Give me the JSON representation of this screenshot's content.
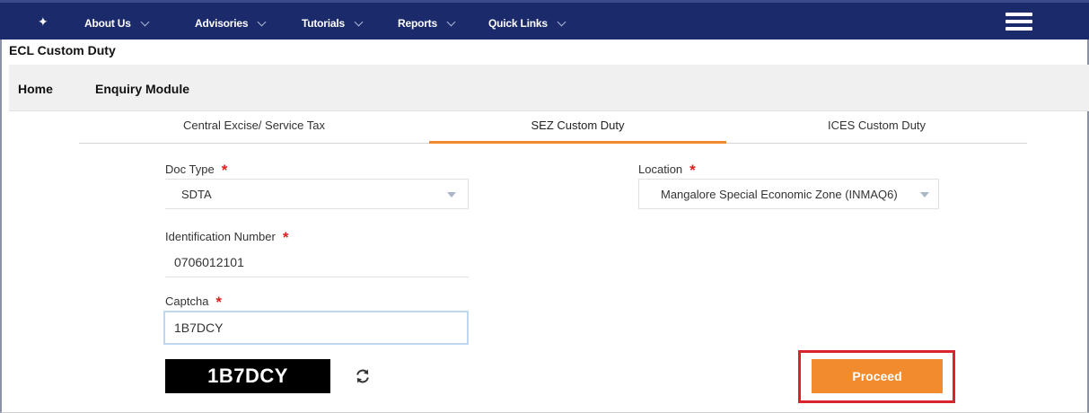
{
  "nav": {
    "home_icon": "home-icon",
    "items": [
      "About Us",
      "Advisories",
      "Tutorials",
      "Reports",
      "Quick Links"
    ],
    "menu_icon": "hamburger-menu-icon"
  },
  "page": {
    "title": "ECL Custom Duty"
  },
  "breadcrumb": {
    "home": "Home",
    "module": "Enquiry Module"
  },
  "tabs": [
    "Central Excise/ Service Tax",
    "SEZ Custom Duty",
    "ICES Custom Duty"
  ],
  "active_tab": 1,
  "form": {
    "doc_type": {
      "label": "Doc Type",
      "value": "SDTA"
    },
    "location": {
      "label": "Location",
      "value": "Mangalore Special Economic Zone (INMAQ6)"
    },
    "identification_number": {
      "label": "Identification Number",
      "value": "0706012101"
    },
    "captcha": {
      "label": "Captcha",
      "value": "1B7DCY",
      "image_text": "1B7DCY"
    },
    "required_marker": "*"
  },
  "actions": {
    "proceed": "Proceed"
  },
  "colors": {
    "nav_bg": "#1b2a6b",
    "accent_orange": "#f28a2e",
    "required_red": "#e02020",
    "highlight_red": "#d9232d"
  }
}
